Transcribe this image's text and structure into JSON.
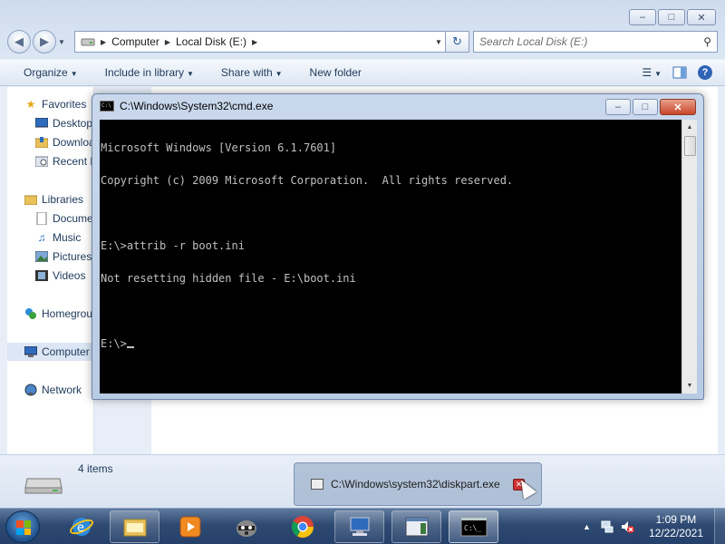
{
  "explorer": {
    "address": {
      "segments": [
        "Computer",
        "Local Disk (E:)"
      ]
    },
    "search": {
      "placeholder": "Search Local Disk (E:)"
    },
    "toolbar": {
      "organize": "Organize",
      "include_in_library": "Include in library",
      "share_with": "Share with",
      "new_folder": "New folder",
      "help": "?"
    },
    "nav": {
      "favorites": "Favorites",
      "desktop": "Desktop",
      "downloads": "Downloads",
      "recent": "Recent Places",
      "libraries": "Libraries",
      "documents": "Documents",
      "music": "Music",
      "pictures": "Pictures",
      "videos": "Videos",
      "homegroup": "Homegroup",
      "computer": "Computer",
      "network": "Network"
    },
    "details": {
      "item_count": "4 items"
    }
  },
  "cmd": {
    "title": "C:\\Windows\\System32\\cmd.exe",
    "lines": [
      "Microsoft Windows [Version 6.1.7601]",
      "Copyright (c) 2009 Microsoft Corporation.  All rights reserved.",
      "",
      "E:\\>attrib -r boot.ini",
      "Not resetting hidden file - E:\\boot.ini",
      "",
      "E:\\>"
    ]
  },
  "taskbar_preview": {
    "title": "C:\\Windows\\system32\\diskpart.exe"
  },
  "clock": {
    "time": "1:09 PM",
    "date": "12/22/2021"
  },
  "colors": {
    "console_bg": "#000000",
    "console_text": "#c0c0c0",
    "taskbar": "#2e4a72"
  }
}
